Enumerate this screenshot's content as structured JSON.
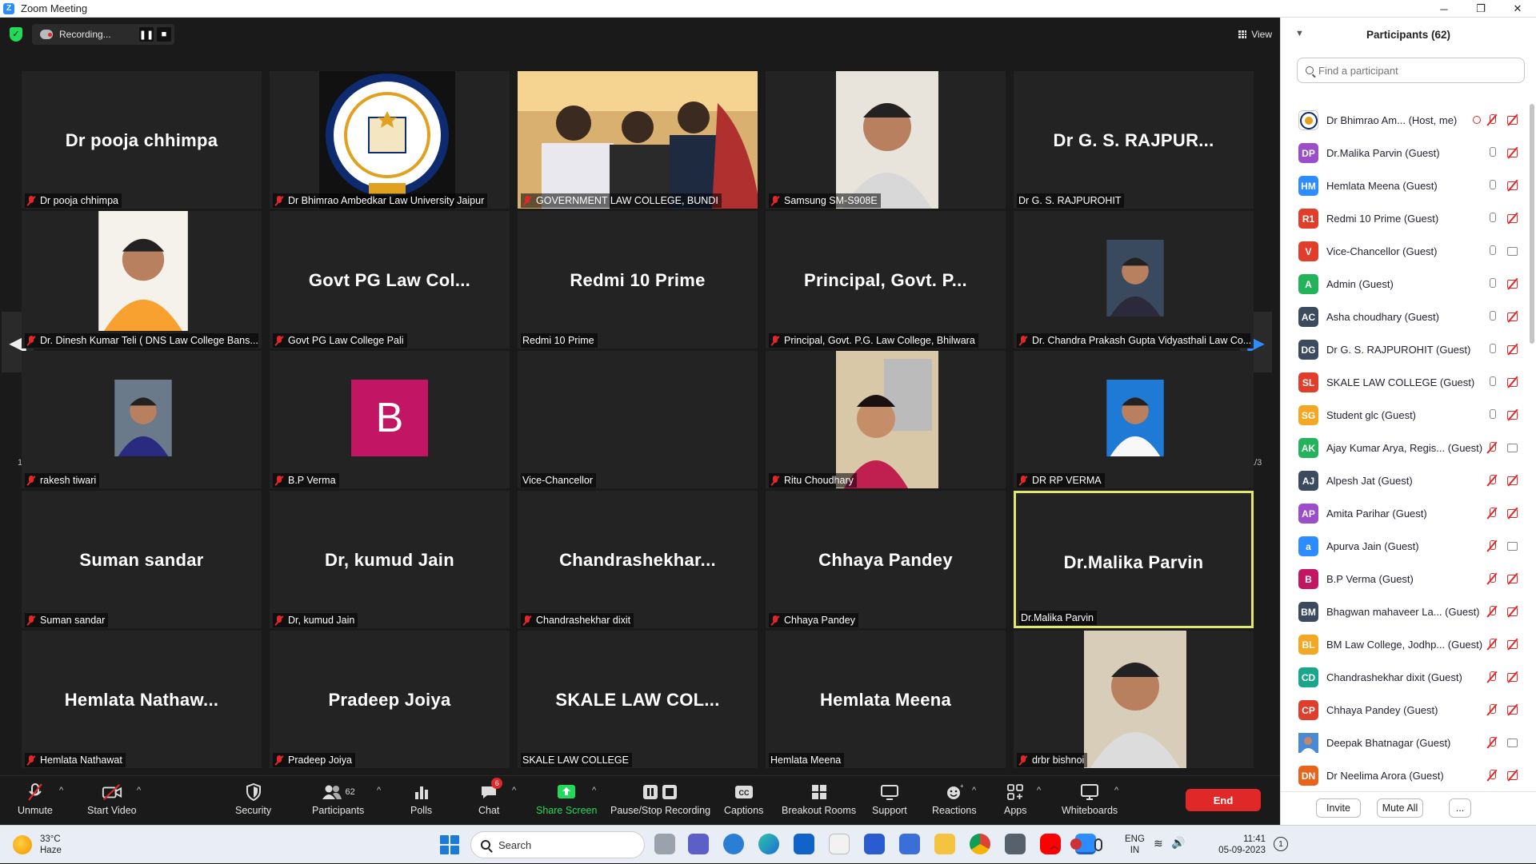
{
  "window": {
    "title": "Zoom Meeting",
    "minimize": "─",
    "maximize": "❐",
    "close": "✕"
  },
  "topbar": {
    "recording_label": "Recording...",
    "pause": "❚❚",
    "stop": "■",
    "view_label": "View"
  },
  "colors": {
    "accent": "#2d8cff",
    "end_red": "#e02828",
    "active_speaker": "#e1e76a",
    "share_green": "#23d959"
  },
  "tiles": [
    {
      "big": "Dr pooja chhimpa",
      "label": "Dr pooja chhimpa",
      "muted": true
    },
    {
      "big": "",
      "label": "Dr Bhimrao Ambedkar Law University Jaipur",
      "muted": true
    },
    {
      "big": "",
      "label": "GOVERNMENT LAW COLLEGE, BUNDI",
      "muted": true
    },
    {
      "big": "",
      "label": "Samsung SM-S908E",
      "muted": true
    },
    {
      "big": "Dr G. S. RAJPUR...",
      "label": "Dr G. S. RAJPUROHIT",
      "muted": false
    },
    {
      "big": "",
      "label": "Dr. Dinesh Kumar Teli ( DNS Law College Bans...",
      "muted": true
    },
    {
      "big": "Govt PG Law Col...",
      "label": "Govt PG Law College Pali",
      "muted": true
    },
    {
      "big": "Redmi 10 Prime",
      "label": "Redmi 10 Prime",
      "muted": false
    },
    {
      "big": "Principal, Govt. P...",
      "label": "Principal, Govt. P.G. Law College, Bhilwara",
      "muted": true
    },
    {
      "big": "",
      "label": "Dr. Chandra Prakash Gupta Vidyasthali Law Co...",
      "muted": true
    },
    {
      "big": "",
      "label": "rakesh tiwari",
      "muted": true
    },
    {
      "big": "",
      "label": "B.P Verma",
      "muted": true
    },
    {
      "big": "",
      "label": "Vice-Chancellor",
      "muted": false
    },
    {
      "big": "",
      "label": "Ritu Choudhary",
      "muted": true
    },
    {
      "big": "",
      "label": "DR RP VERMA",
      "muted": true
    },
    {
      "big": "Suman sandar",
      "label": "Suman sandar",
      "muted": true
    },
    {
      "big": "Dr, kumud Jain",
      "label": "Dr, kumud Jain",
      "muted": true
    },
    {
      "big": "Chandrashekhar...",
      "label": "Chandrashekhar dixit",
      "muted": true
    },
    {
      "big": "Chhaya Pandey",
      "label": "Chhaya Pandey",
      "muted": true
    },
    {
      "big": "Dr.Malika Parvin",
      "label": "Dr.Malika Parvin",
      "muted": false
    },
    {
      "big": "Hemlata Nathaw...",
      "label": "Hemlata Nathawat",
      "muted": true
    },
    {
      "big": "Pradeep Joiya",
      "label": "Pradeep Joiya",
      "muted": true
    },
    {
      "big": "SKALE LAW COL...",
      "label": "SKALE LAW COLLEGE",
      "muted": false
    },
    {
      "big": "Hemlata Meena",
      "label": "Hemlata Meena",
      "muted": false
    },
    {
      "big": "",
      "label": "drbr bishnoi",
      "muted": true
    }
  ],
  "avatar_b_letter": "B",
  "pager": {
    "left": "1/3",
    "right": "1/3",
    "prev": "◀",
    "next": "▶"
  },
  "toolbar": {
    "unmute": "Unmute",
    "start_video": "Start Video",
    "security": "Security",
    "participants": "Participants",
    "participants_count": "62",
    "polls": "Polls",
    "chat": "Chat",
    "chat_badge": "6",
    "share_screen": "Share Screen",
    "pause_stop": "Pause/Stop Recording",
    "captions": "Captions",
    "captions_icon": "CC",
    "breakout": "Breakout Rooms",
    "support": "Support",
    "reactions": "Reactions",
    "apps": "Apps",
    "whiteboards": "Whiteboards",
    "end": "End",
    "caret": "^"
  },
  "panel": {
    "title": "Participants (62)",
    "search_placeholder": "Find a participant",
    "invite": "Invite",
    "mute_all": "Mute All",
    "more": "...",
    "participants": [
      {
        "initials": "",
        "name": "Dr Bhimrao Am...",
        "role": "(Host, me)",
        "color": "#ffffff",
        "mic": "red",
        "cam": "red",
        "logo": true
      },
      {
        "initials": "DP",
        "name": "Dr.Malika Parvin",
        "role": "(Guest)",
        "color": "#9b4dca",
        "mic": "gray",
        "cam": "red"
      },
      {
        "initials": "HM",
        "name": "Hemlata Meena",
        "role": "(Guest)",
        "color": "#2d8cff",
        "mic": "gray",
        "cam": "red"
      },
      {
        "initials": "R1",
        "name": "Redmi 10 Prime",
        "role": "(Guest)",
        "color": "#e03d2b",
        "mic": "gray",
        "cam": "red"
      },
      {
        "initials": "V",
        "name": "Vice-Chancellor",
        "role": "(Guest)",
        "color": "#e03d2b",
        "mic": "gray",
        "cam": "gray"
      },
      {
        "initials": "A",
        "name": "Admin",
        "role": "(Guest)",
        "color": "#23b35a",
        "mic": "gray",
        "cam": "red"
      },
      {
        "initials": "AC",
        "name": "Asha choudhary",
        "role": "(Guest)",
        "color": "#3b4a5e",
        "mic": "gray",
        "cam": "red"
      },
      {
        "initials": "DG",
        "name": "Dr G. S. RAJPUROHIT",
        "role": "(Guest)",
        "color": "#3b4a5e",
        "mic": "gray",
        "cam": "red"
      },
      {
        "initials": "SL",
        "name": "SKALE LAW COLLEGE",
        "role": "(Guest)",
        "color": "#e03d2b",
        "mic": "gray",
        "cam": "red"
      },
      {
        "initials": "SG",
        "name": "Student glc",
        "role": "(Guest)",
        "color": "#f5a623",
        "mic": "gray",
        "cam": "red"
      },
      {
        "initials": "AK",
        "name": "Ajay Kumar Arya, Regis...",
        "role": "(Guest)",
        "color": "#23b35a",
        "mic": "red",
        "cam": "gray"
      },
      {
        "initials": "AJ",
        "name": "Alpesh Jat",
        "role": "(Guest)",
        "color": "#3b4a5e",
        "mic": "red",
        "cam": "red"
      },
      {
        "initials": "AP",
        "name": "Amita Parihar",
        "role": "(Guest)",
        "color": "#9b4dca",
        "mic": "red",
        "cam": "red"
      },
      {
        "initials": "a",
        "name": "Apurva Jain",
        "role": "(Guest)",
        "color": "#2d8cff",
        "mic": "red",
        "cam": "gray"
      },
      {
        "initials": "B",
        "name": "B.P Verma",
        "role": "(Guest)",
        "color": "#c21664",
        "mic": "red",
        "cam": "red"
      },
      {
        "initials": "BM",
        "name": "Bhagwan mahaveer La...",
        "role": "(Guest)",
        "color": "#3b4a5e",
        "mic": "red",
        "cam": "red"
      },
      {
        "initials": "BL",
        "name": "BM Law College, Jodhp...",
        "role": "(Guest)",
        "color": "#f5a623",
        "mic": "red",
        "cam": "red"
      },
      {
        "initials": "CD",
        "name": "Chandrashekhar dixit",
        "role": "(Guest)",
        "color": "#1aa68a",
        "mic": "red",
        "cam": "red"
      },
      {
        "initials": "CP",
        "name": "Chhaya Pandey",
        "role": "(Guest)",
        "color": "#e03d2b",
        "mic": "red",
        "cam": "red"
      },
      {
        "initials": "",
        "name": "Deepak Bhatnagar",
        "role": "(Guest)",
        "color": "#6a7a8a",
        "mic": "red",
        "cam": "gray",
        "photo": true
      },
      {
        "initials": "DN",
        "name": "Dr Neelima Arora",
        "role": "(Guest)",
        "color": "#e8641b",
        "mic": "red",
        "cam": "red"
      }
    ]
  },
  "taskbar": {
    "temp": "33°C",
    "weather": "Haze",
    "search": "Search",
    "lang1": "ENG",
    "lang2": "IN",
    "time": "11:41",
    "date": "05-09-2023",
    "notif": "1"
  }
}
